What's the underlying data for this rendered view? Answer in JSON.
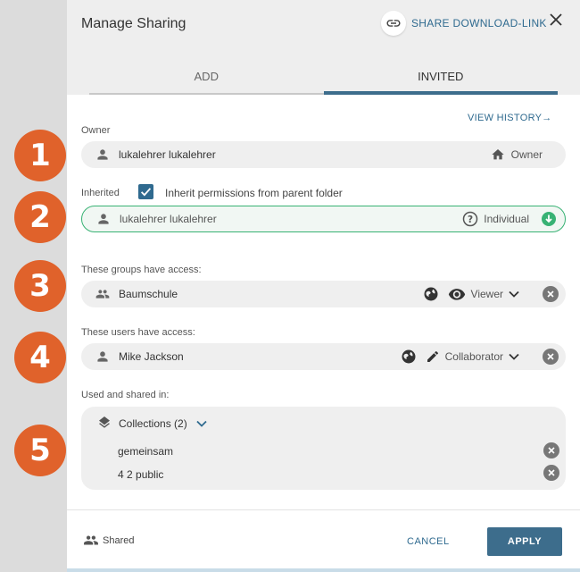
{
  "dialog": {
    "title": "Manage Sharing",
    "share_link_label": "SHARE DOWNLOAD-LINK",
    "tabs": [
      {
        "label": "ADD"
      },
      {
        "label": "INVITED"
      }
    ],
    "view_history": "VIEW HISTORY",
    "owner_section": {
      "label": "Owner",
      "name": "lukalehrer lukalehrer",
      "role": "Owner"
    },
    "inherited_section": {
      "label": "Inherited",
      "checkbox_checked": true,
      "checkbox_label": "Inherit permissions from parent folder",
      "name": "lukalehrer lukalehrer",
      "role": "Individual"
    },
    "groups_section": {
      "label": "These groups have access:",
      "name": "Baumschule",
      "role": "Viewer"
    },
    "users_section": {
      "label": "These users have access:",
      "name": "Mike Jackson",
      "role": "Collaborator"
    },
    "used_section": {
      "label": "Used and shared in:",
      "collections_label": "Collections (2)",
      "items": [
        {
          "name": "gemeinsam"
        },
        {
          "name": "4 2 public"
        }
      ]
    },
    "footer": {
      "shared_label": "Shared",
      "cancel": "CANCEL",
      "apply": "APPLY"
    }
  },
  "callouts": [
    "1",
    "2",
    "3",
    "4",
    "5"
  ],
  "colors": {
    "accent": "#3d6d8c",
    "callout": "#e0622b",
    "inherited_border": "#38b274"
  }
}
